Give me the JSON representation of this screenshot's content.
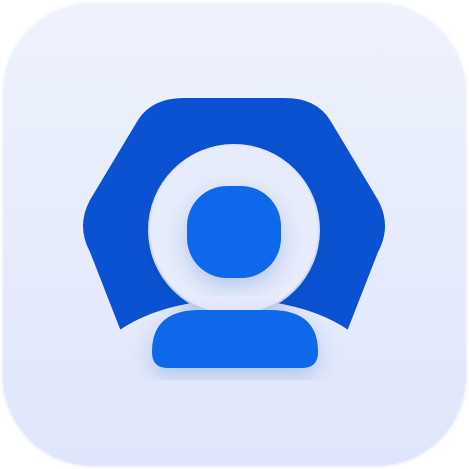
{
  "app_icon": {
    "name": "user-profile-app-icon",
    "icon": "user-avatar-icon",
    "colors": {
      "tile_top": "#eef2fd",
      "tile_bottom": "#dfe6fb",
      "hex_shape": "#0a52d1",
      "person": "#0f67ea",
      "ring_halo": "#e6ecfb"
    }
  }
}
